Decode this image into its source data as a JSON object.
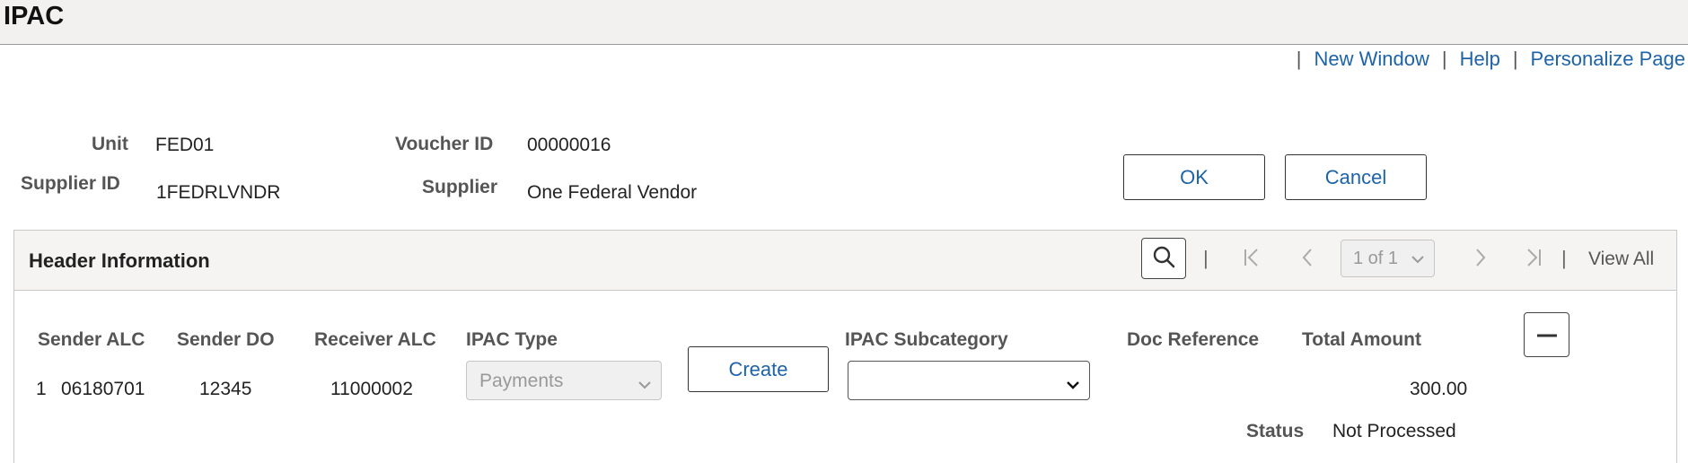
{
  "title": "IPAC",
  "links": {
    "new_window": "New Window",
    "help": "Help",
    "personalize": "Personalize Page",
    "separator": "|"
  },
  "header_fields": {
    "unit_label": "Unit",
    "unit_value": "FED01",
    "voucher_label": "Voucher ID",
    "voucher_value": "00000016",
    "supplier_id_label": "Supplier ID",
    "supplier_id_value": "1FEDRLVNDR",
    "supplier_label": "Supplier",
    "supplier_value": "One Federal Vendor"
  },
  "buttons": {
    "ok": "OK",
    "cancel": "Cancel",
    "create": "Create"
  },
  "panel": {
    "title": "Header Information",
    "pager_text": "1 of 1",
    "view_all": "View All"
  },
  "columns": {
    "sender_alc": "Sender ALC",
    "sender_do": "Sender DO",
    "receiver_alc": "Receiver ALC",
    "ipac_type": "IPAC Type",
    "ipac_subcategory": "IPAC Subcategory",
    "doc_reference": "Doc Reference",
    "total_amount": "Total Amount"
  },
  "row": {
    "number": "1",
    "sender_alc": "06180701",
    "sender_do": "12345",
    "receiver_alc": "11000002",
    "ipac_type": "Payments",
    "ipac_subcategory": "",
    "doc_reference": "",
    "total_amount": "300.00",
    "status_label": "Status",
    "status_value": "Not Processed"
  },
  "icons": {
    "search": "search-icon",
    "first": "first-page-icon",
    "prev": "previous-icon",
    "next": "next-icon",
    "last": "last-page-icon",
    "chevron": "chevron-down-icon",
    "delete_row": "minus-icon"
  },
  "colors": {
    "link": "#1d63a8",
    "title_bar": "#f2f1f0",
    "panel_header": "#f5f4f3"
  }
}
